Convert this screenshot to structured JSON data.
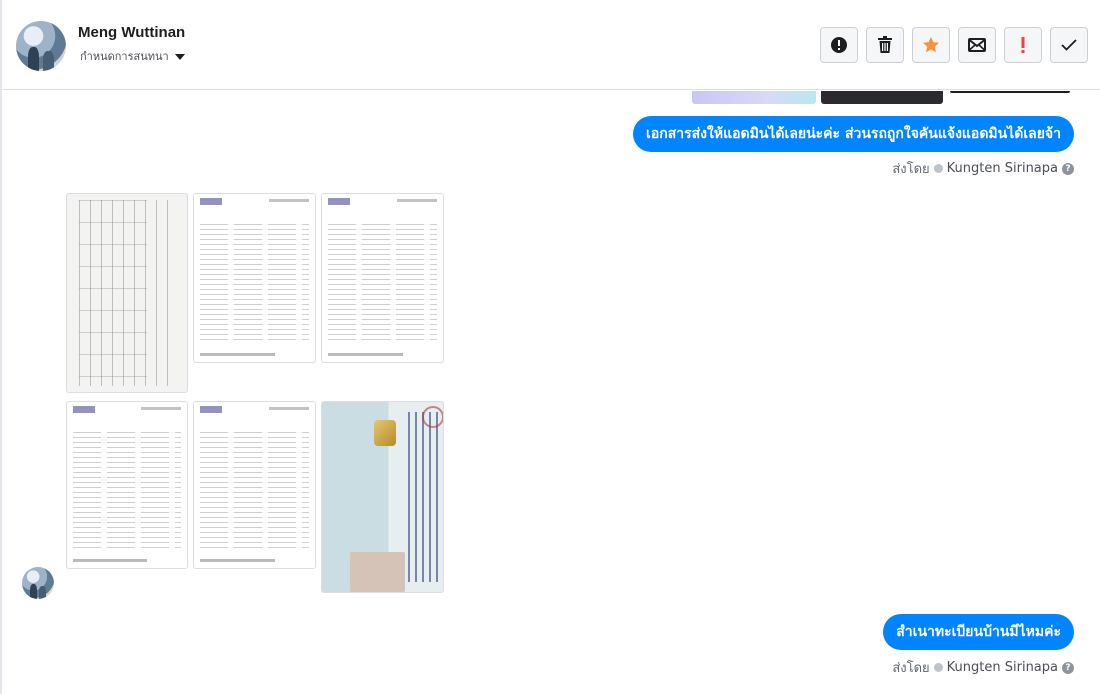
{
  "header": {
    "contact_name": "Meng Wuttinan",
    "assign_label": "กำหนดการสนทนา",
    "actions": [
      {
        "name": "spam-button",
        "icon": "alert-circle-icon"
      },
      {
        "name": "delete-button",
        "icon": "trash-icon"
      },
      {
        "name": "star-button",
        "icon": "star-icon"
      },
      {
        "name": "mark-unread-button",
        "icon": "envelope-icon"
      },
      {
        "name": "priority-button",
        "icon": "exclamation-icon"
      },
      {
        "name": "done-button",
        "icon": "check-icon"
      }
    ]
  },
  "colors": {
    "bubble": "#0084ff",
    "star": "#f7923b",
    "priority": "#fa3e3e"
  },
  "messages": [
    {
      "text": "เอกสารส่งให้แอดมินได้เลยน่ะค่ะ ส่วนรถถูกใจคันแจ้งแอดมินได้เลยจ้า",
      "sent_by_label": "ส่งโดย",
      "agent": "Kungten Sirinapa"
    },
    {
      "text": "สำเนาทะเบียนบ้านมีไหมค่ะ",
      "sent_by_label": "ส่งโดย",
      "agent": "Kungten Sirinapa"
    }
  ],
  "attachments": [
    {
      "kind": "rotated-document"
    },
    {
      "kind": "statement"
    },
    {
      "kind": "statement"
    },
    {
      "kind": "statement"
    },
    {
      "kind": "statement"
    },
    {
      "kind": "id-card"
    }
  ]
}
